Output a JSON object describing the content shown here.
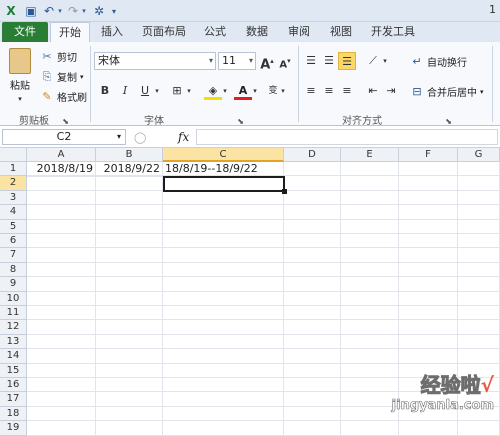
{
  "titlebar": {
    "page_indicator": "1"
  },
  "tabs": [
    "文件",
    "开始",
    "插入",
    "页面布局",
    "公式",
    "数据",
    "审阅",
    "视图",
    "开发工具"
  ],
  "ribbon": {
    "clipboard": {
      "paste": "粘贴",
      "cut": "剪切",
      "copy": "复制",
      "format_painter": "格式刷",
      "label": "剪贴板"
    },
    "font": {
      "font_name": "宋体",
      "font_size": "11",
      "grow": "A",
      "shrink": "A",
      "bold": "B",
      "italic": "I",
      "underline": "U",
      "label": "字体"
    },
    "alignment": {
      "wrap_text": "自动换行",
      "merge_center": "合并后居中",
      "label": "对齐方式"
    }
  },
  "formula_bar": {
    "name_box": "C2",
    "fx": "fx",
    "content": ""
  },
  "sheet": {
    "columns": [
      "A",
      "B",
      "C",
      "D",
      "E",
      "F",
      "G"
    ],
    "selected_column": "C",
    "rows": [
      "1",
      "2",
      "3",
      "4",
      "5",
      "6",
      "7",
      "8",
      "9",
      "10",
      "11",
      "12",
      "13",
      "14",
      "15",
      "16",
      "17",
      "18",
      "19"
    ],
    "selected_row": "2",
    "cells": {
      "A1": "2018/8/19",
      "B1": "2018/9/22",
      "C1": "18/8/19--18/9/22"
    }
  },
  "watermark": {
    "main": "经验啦",
    "check": "√",
    "sub": "jingyanla.com"
  }
}
